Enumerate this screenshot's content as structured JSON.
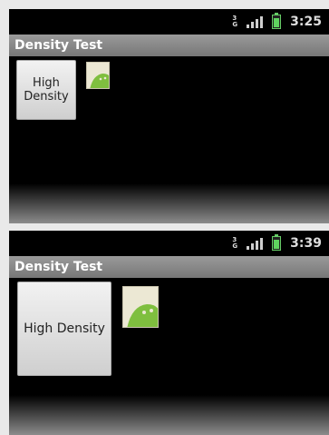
{
  "screens": [
    {
      "status_time": "3:25",
      "network_label": "3G",
      "app_title": "Density Test",
      "button_label": "High Density",
      "image_icon": "android-robot-icon"
    },
    {
      "status_time": "3:39",
      "network_label": "3G",
      "app_title": "Density Test",
      "button_label": "High Density",
      "image_icon": "android-robot-icon"
    }
  ],
  "colors": {
    "screen_bg": "#000000",
    "titlebar": "#888888",
    "battery": "#5fd35f",
    "page_bg": "#e9e9e9"
  }
}
